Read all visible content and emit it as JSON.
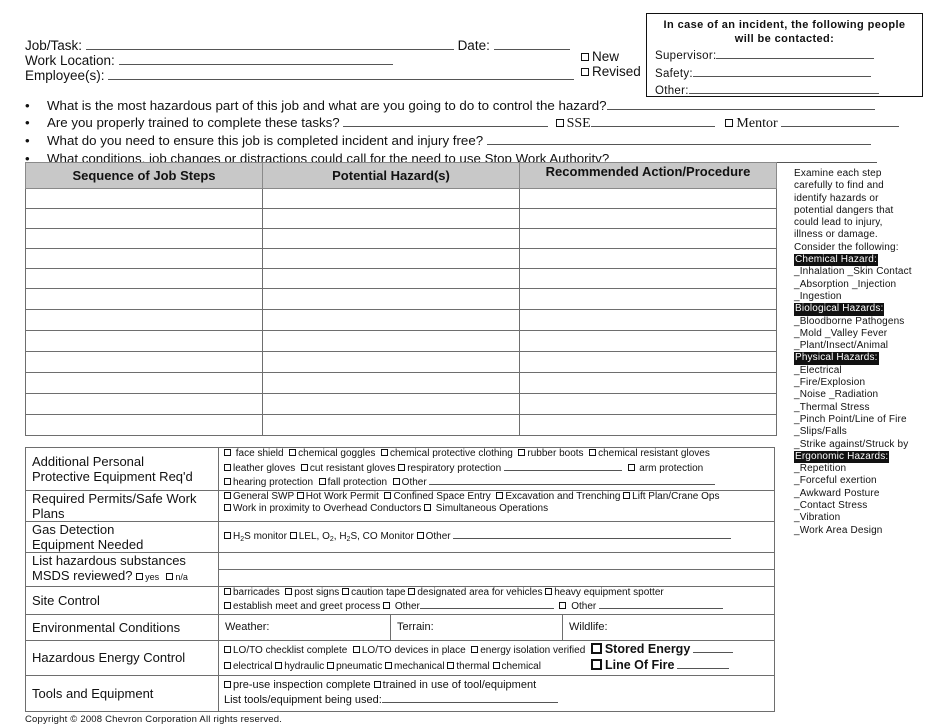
{
  "header": {
    "job_task_label": "Job/Task:",
    "date_label": "Date:",
    "work_location_label": "Work Location:",
    "employees_label": "Employee(s):",
    "new_label": "New",
    "revised_label": "Revised"
  },
  "contact_box": {
    "title_line1": "In case of an incident, the following people",
    "title_line2": "will be contacted:",
    "supervisor_label": "Supervisor:",
    "safety_label": "Safety:",
    "other_label": "Other:"
  },
  "questions": {
    "q1": "What is the most hazardous part of this job and what are you going to do to control the hazard?",
    "q2": "Are you properly trained to complete these tasks?",
    "q2_sse": "SSE",
    "q2_mentor": "Mentor",
    "q3": "What do you need to ensure this job is completed incident and injury free?",
    "q4": "What conditions, job changes or distractions could call for the need to use Stop Work Authority?"
  },
  "steps_table": {
    "columns": [
      "Sequence of Job Steps",
      "Potential Hazard(s)",
      "Recommended Action/Procedure"
    ],
    "row_count": 12
  },
  "guide": {
    "intro": [
      "Examine each step",
      "carefully to find and",
      "identify hazards or",
      "potential dangers that",
      "could lead to injury,",
      "illness or damage.",
      "Consider the following:"
    ],
    "chemical_title": "Chemical Hazard:",
    "chemical_items": [
      "_Inhalation _Skin Contact",
      "_Absorption _Injection",
      "_Ingestion"
    ],
    "biological_title": "Biological Hazards:",
    "biological_items": [
      "_Bloodborne Pathogens",
      "_Mold _Valley Fever",
      "_Plant/Insect/Animal"
    ],
    "physical_title": "Physical Hazards:",
    "physical_items": [
      "_Electrical",
      "_Fire/Explosion",
      "_Noise _Radiation",
      "_Thermal Stress",
      "_Pinch Point/Line of Fire",
      "_Slips/Falls",
      "_Strike against/Struck by"
    ],
    "ergonomic_title": "Ergonomic Hazards:",
    "ergonomic_items": [
      "_Repetition",
      "_Forceful exertion",
      "_Awkward Posture",
      "_Contact Stress",
      "_Vibration",
      "_Work Area Design"
    ]
  },
  "bottom": {
    "ppe": {
      "label_line1": "Additional Personal",
      "label_line2": "Protective Equipment Req'd",
      "opts": [
        "face shield",
        "chemical goggles",
        "chemical protective clothing",
        "rubber boots",
        "chemical resistant gloves",
        "leather gloves",
        "cut resistant gloves",
        "respiratory protection",
        "arm protection",
        "hearing protection",
        "fall protection",
        "Other"
      ]
    },
    "permits": {
      "label_line1": "Required Permits/Safe Work",
      "label_line2": "Plans",
      "opts": [
        "General SWP",
        "Hot Work Permit",
        "Confined Space Entry",
        "Excavation and Trenching",
        "Lift Plan/Crane Ops",
        "Work in proximity to Overhead Conductors",
        "Simultaneous Operations"
      ]
    },
    "gas": {
      "label_line1": "Gas Detection",
      "label_line2": "Equipment Needed",
      "opt_h2s_pre": "H",
      "opt_h2s_sub": "2",
      "opt_h2s_post": "S monitor",
      "opt_lel_a": "LEL, O",
      "opt_lel_b": ", H",
      "opt_lel_c": "S, CO Monitor",
      "opt_other": "Other"
    },
    "msds": {
      "label_line1": "List hazardous substances",
      "label_line2": "MSDS reviewed?",
      "yes": "yes",
      "na": "n/a"
    },
    "site": {
      "label": "Site Control",
      "opts": [
        "barricades",
        "post signs",
        "caution tape",
        "designated area for vehicles",
        "heavy equipment spotter",
        "establish meet and greet process",
        "Other",
        "Other"
      ]
    },
    "env": {
      "label": "Environmental Conditions",
      "weather": "Weather:",
      "terrain": "Terrain:",
      "wildlife": "Wildlife:"
    },
    "energy": {
      "label": "Hazardous Energy Control",
      "opts": [
        "LO/TO checklist complete",
        "LO/TO devices in place",
        "energy isolation verified",
        "electrical",
        "hydraulic",
        "pneumatic",
        "mechanical",
        "thermal",
        "chemical"
      ],
      "stored_energy": "Stored Energy",
      "line_of_fire": "Line Of Fire"
    },
    "tools": {
      "label": "Tools and Equipment",
      "opt1": "pre-use inspection complete",
      "opt2": "trained in use of tool/equipment",
      "list_label": "List tools/equipment being used:"
    }
  },
  "copyright": "Copyright © 2008 Chevron Corporation All rights reserved."
}
